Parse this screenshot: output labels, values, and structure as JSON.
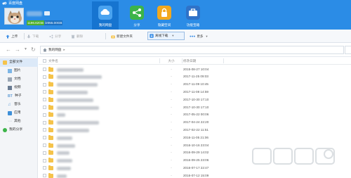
{
  "app": {
    "title": "百度网盘"
  },
  "account": {
    "quota_used": "1196.62GB",
    "quota_total": "/2055.00GB"
  },
  "nav": [
    {
      "label": "我的网盘",
      "icon": "cloud-icon",
      "color": "#4aa3f0"
    },
    {
      "label": "分享",
      "icon": "share-icon",
      "color": "#3cb449"
    },
    {
      "label": "隐藏空间",
      "icon": "lock-icon",
      "color": "#f2a81d"
    },
    {
      "label": "功能宝箱",
      "icon": "toolbox-icon",
      "color": "#2f72c8"
    }
  ],
  "toolbar": {
    "upload": "上传",
    "download": "下载",
    "share": "分享",
    "delete": "删除",
    "new_folder": "新建文件夹",
    "offline_download": "离线下载",
    "more": "更多"
  },
  "address": {
    "current": "我的网盘"
  },
  "sidebar": [
    {
      "label": "全部文件",
      "icon": "folder-icon",
      "color": "#f5c34a"
    },
    {
      "label": "图片",
      "icon": "image-icon",
      "color": "#7db6e6"
    },
    {
      "label": "文档",
      "icon": "document-icon",
      "color": "#9aa7b5"
    },
    {
      "label": "视频",
      "icon": "video-icon",
      "color": "#6a7c93"
    },
    {
      "label": "种子",
      "icon": "torrent-icon",
      "color": "#5e9bd5"
    },
    {
      "label": "音乐",
      "icon": "music-icon",
      "color": "#5e9bd5"
    },
    {
      "label": "应用",
      "icon": "app-icon",
      "color": "#3e8fd8"
    },
    {
      "label": "其他",
      "icon": "other-icon",
      "color": "#9aa7b5"
    },
    {
      "label": "我的分享",
      "icon": "share-icon",
      "color": "#3cb449"
    }
  ],
  "list": {
    "col_name": "文件名",
    "col_size": "大小",
    "col_date": "修改日期",
    "rows": [
      {
        "name": "",
        "size": "-",
        "date": "2015-08-27 10:04"
      },
      {
        "name": "",
        "size": "-",
        "date": "2017-11-25 09:03"
      },
      {
        "name": "",
        "size": "-",
        "date": "2017-11-09 10:45"
      },
      {
        "name": "",
        "size": "-",
        "date": "2017-11-08 14:59"
      },
      {
        "name": "",
        "size": "-",
        "date": "2017-10-30 17:10"
      },
      {
        "name": "",
        "size": "-",
        "date": "2017-10-30 17:10"
      },
      {
        "name": "",
        "size": "-",
        "date": "2017-05-22 00:06"
      },
      {
        "name": "",
        "size": "-",
        "date": "2017-04-24 22:20"
      },
      {
        "name": "",
        "size": "-",
        "date": "2017-02-22 11:51"
      },
      {
        "name": "",
        "size": "-",
        "date": "2016-11-05 21:06"
      },
      {
        "name": "",
        "size": "-",
        "date": "2016-10-16 23:04"
      },
      {
        "name": "",
        "size": "-",
        "date": "2016-09-29 14:02"
      },
      {
        "name": "",
        "size": "-",
        "date": "2016-09-25 23:06"
      },
      {
        "name": "",
        "size": "-",
        "date": "2016-07-17 22:47"
      },
      {
        "name": "",
        "size": "-",
        "date": "2016-07-12 15:09"
      }
    ]
  }
}
